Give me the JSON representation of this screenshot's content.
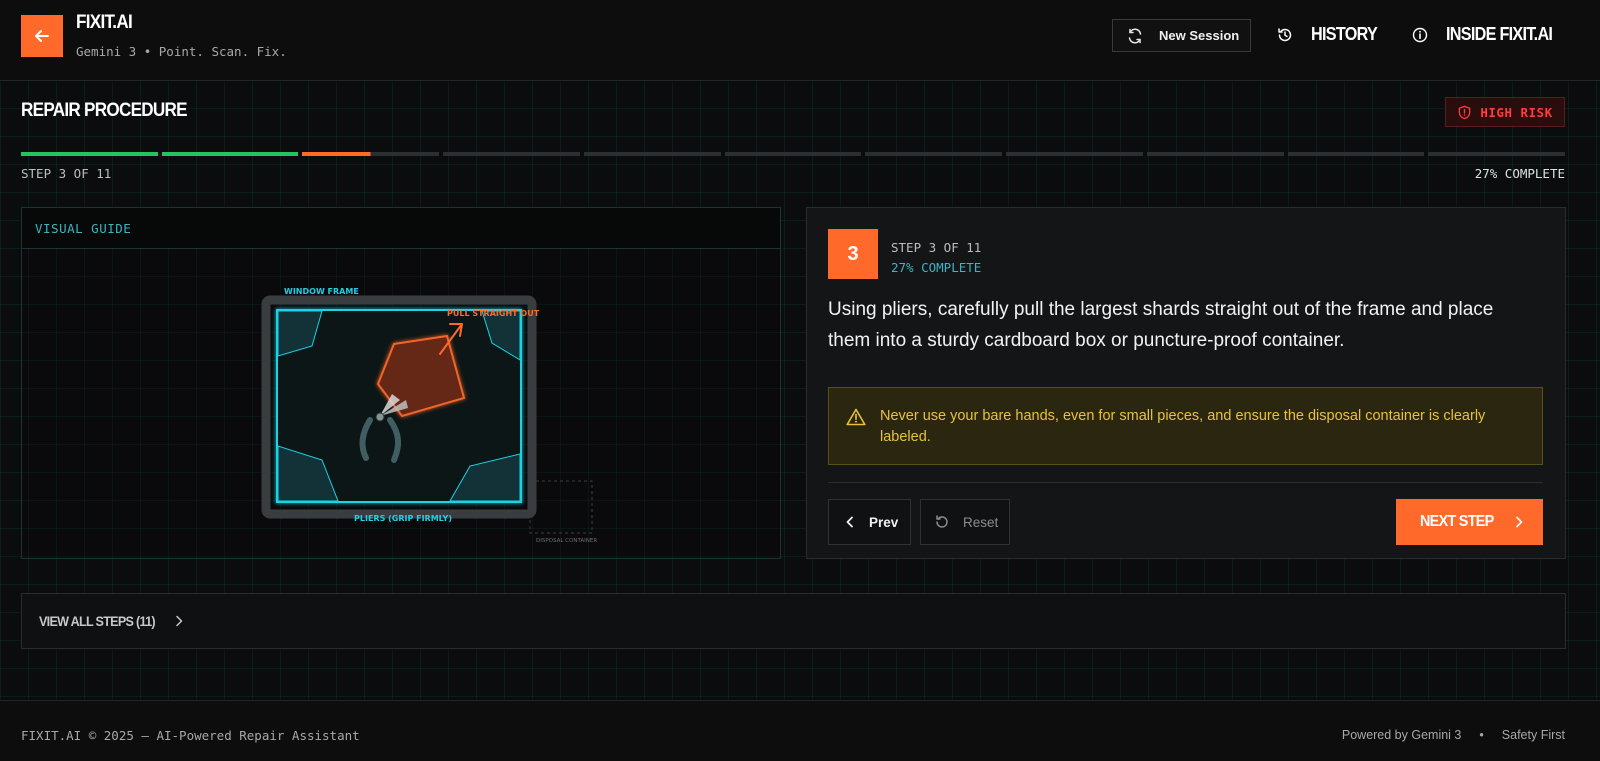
{
  "header": {
    "brand": "FIXIT.AI",
    "tagline": "Gemini 3 • Point. Scan. Fix.",
    "new_session_label": "New Session",
    "history_label": "HISTORY",
    "inside_label": "INSIDE FIXIT.AI"
  },
  "procedure": {
    "title": "REPAIR PROCEDURE",
    "risk_label": "HIGH RISK",
    "step_count_label": "STEP 3 OF 11",
    "complete_label": "27% COMPLETE",
    "total_steps": 11,
    "steps_done": 2,
    "current_step": 3,
    "current_step_fraction": 0.5,
    "colors": {
      "done": "#22c55e",
      "current": "#ff6a2b",
      "pending": "#2c2f31",
      "accent": "#ff6a2b",
      "cyan": "#3bb4c4"
    }
  },
  "visual_guide": {
    "title": "VISUAL GUIDE",
    "labels": {
      "window_frame": "WINDOW FRAME",
      "pull": "PULL STRAIGHT OUT",
      "pliers": "PLIERS (GRIP FIRMLY)",
      "disposal": "DISPOSAL CONTAINER"
    }
  },
  "step_card": {
    "number": "3",
    "step_label": "STEP 3 OF 11",
    "complete_label": "27% COMPLETE",
    "instruction": "Using pliers, carefully pull the largest shards straight out of the frame and place them into a sturdy cardboard box or puncture-proof container.",
    "warning": "Never use your bare hands, even for small pieces, and ensure the disposal container is clearly labeled.",
    "prev_label": "Prev",
    "reset_label": "Reset",
    "next_label": "NEXT STEP"
  },
  "all_steps": {
    "label": "VIEW ALL STEPS (11)"
  },
  "footer": {
    "copyright": "FIXIT.AI © 2025 — AI-Powered Repair Assistant",
    "powered": "Powered by Gemini 3",
    "separator": "•",
    "safety": "Safety First"
  }
}
